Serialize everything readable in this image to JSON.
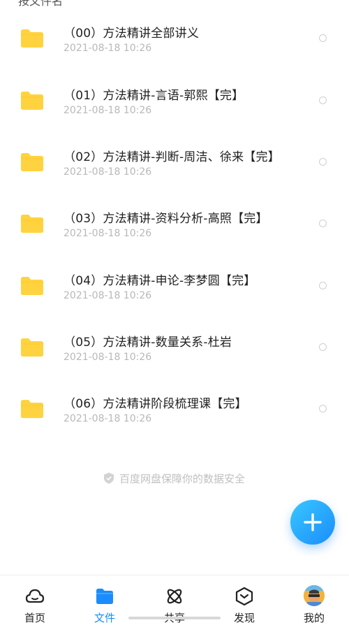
{
  "header": {
    "sort_label": "按文件名"
  },
  "files": [
    {
      "name": "（00）方法精讲全部讲义",
      "date": "2021-08-18  10:26"
    },
    {
      "name": "（01）方法精讲-言语-郭熙【完】",
      "date": "2021-08-18  10:26"
    },
    {
      "name": "（02）方法精讲-判断-周洁、徐来【完】",
      "date": "2021-08-18  10:26"
    },
    {
      "name": "（03）方法精讲-资料分析-高照【完】",
      "date": "2021-08-18  10:26"
    },
    {
      "name": "（04）方法精讲-申论-李梦圆【完】",
      "date": "2021-08-18  10:26"
    },
    {
      "name": "（05）方法精讲-数量关系-杜岩",
      "date": "2021-08-18  10:26"
    },
    {
      "name": "（06）方法精讲阶段梳理课【完】",
      "date": "2021-08-18  10:26"
    }
  ],
  "security_note": "百度网盘保障你的数据安全",
  "tabs": [
    {
      "label": "首页",
      "icon": "cloud-icon"
    },
    {
      "label": "文件",
      "icon": "folder-icon"
    },
    {
      "label": "共享",
      "icon": "share-icon"
    },
    {
      "label": "发现",
      "icon": "discover-icon"
    },
    {
      "label": "我的",
      "icon": "avatar"
    }
  ],
  "colors": {
    "accent": "#1b8cfb",
    "folder": "#ffd340"
  }
}
